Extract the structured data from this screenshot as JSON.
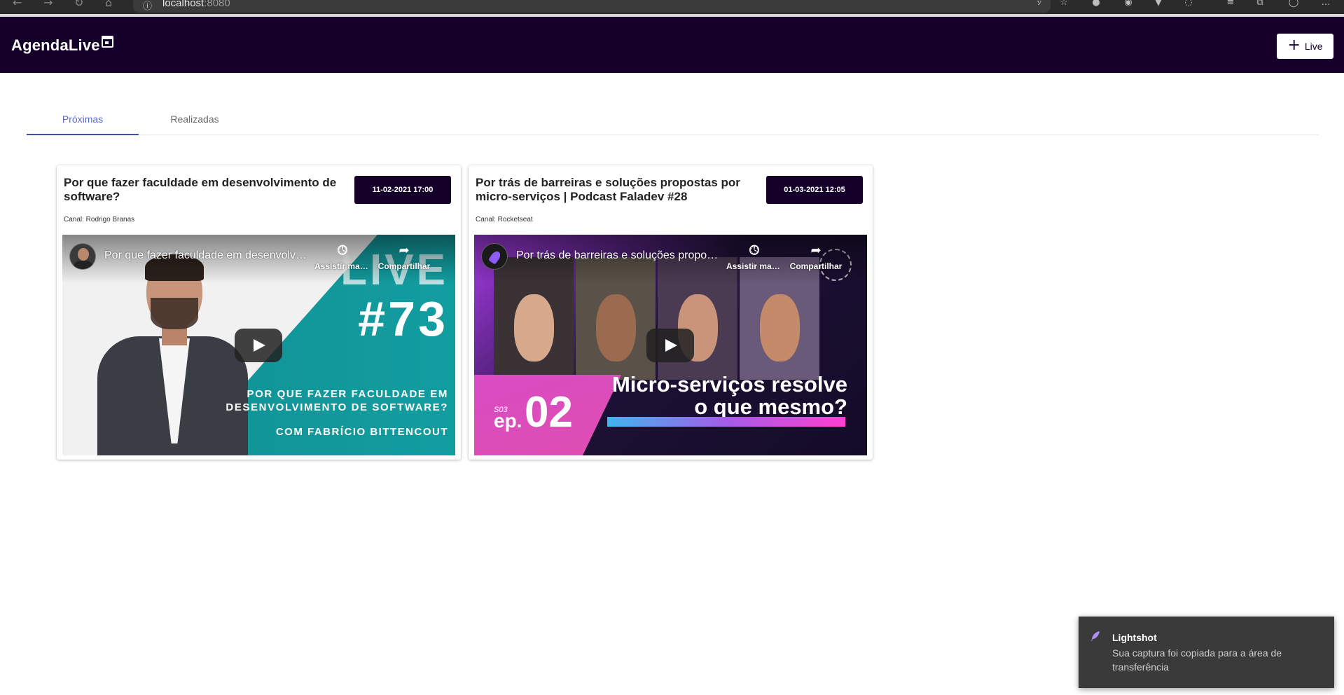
{
  "browser": {
    "url_host": "localhost",
    "url_port": ":8080",
    "back_icon": "arrow-left-icon",
    "forward_icon": "arrow-right-icon",
    "reload_icon": "reload-icon",
    "home_icon": "home-icon",
    "info_icon": "info-icon"
  },
  "header": {
    "brand": "AgendaLive",
    "brand_icon": "calendar-icon",
    "add_button_label": "Live",
    "add_button_icon": "plus-icon",
    "background": "#140029"
  },
  "tabs": [
    {
      "label": "Próximas",
      "active": true
    },
    {
      "label": "Realizadas",
      "active": false
    }
  ],
  "accent_color": "#3f51b5",
  "cards": [
    {
      "title": "Por que fazer faculdade em desenvolvimento de software?",
      "date": "11-02-2021 17:00",
      "channel": "Canal: Rodrigo Branas",
      "video": {
        "overlay_title": "Por que fazer faculdade em desenvolvimento de software?",
        "watch_later": "Assistir mais tarde",
        "share": "Compartilhar",
        "thumb_live": "LIVE",
        "thumb_number": "#73",
        "thumb_subtitle_1": "POR QUE FAZER FACULDADE EM",
        "thumb_subtitle_2": "DESENVOLVIMENTO DE SOFTWARE?",
        "thumb_with": "COM FABRÍCIO BITTENCOUT"
      }
    },
    {
      "title": "Por trás de barreiras e soluções propostas por micro-serviços | Podcast Faladev #28",
      "date": "01-03-2021 12:05",
      "channel": "Canal: Rocketseat",
      "video": {
        "overlay_title": "Por trás de barreiras e soluções propostas por micro-serviços",
        "watch_later": "Assistir mais tarde",
        "share": "Compartilhar",
        "thumb_season": "S03",
        "thumb_ep": "ep.",
        "thumb_ep_number": "02",
        "thumb_headline_1": "Micro-serviços resolve",
        "thumb_headline_2": "o que mesmo?"
      }
    }
  ],
  "toast": {
    "icon": "feather-icon",
    "title": "Lightshot",
    "message": "Sua captura foi copiada para a área de transferência"
  }
}
